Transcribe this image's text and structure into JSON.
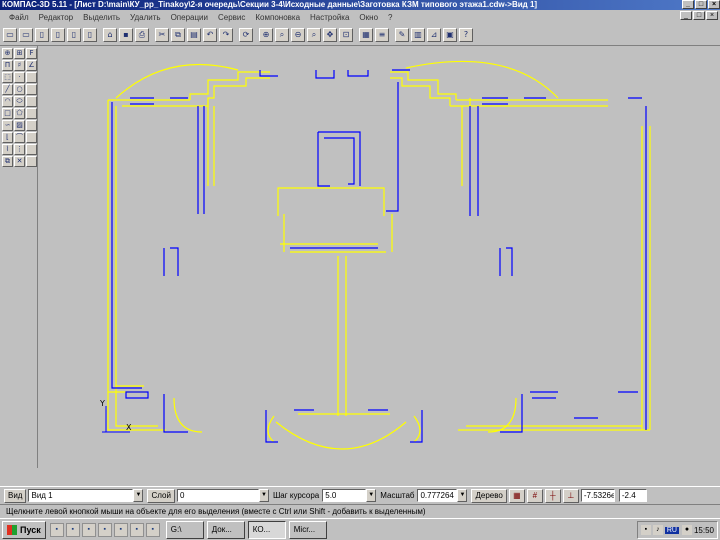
{
  "window": {
    "title": "КОМПАС-3D 5.11 - [Лист D:\\main\\КУ_pp_Tinakoy\\2-я очередь\\Секции 3-4\\Исходные данные\\Заготовка КЗМ типового этажа1.cdw->Вид 1]",
    "min_label": "_",
    "max_label": "□",
    "close_label": "×"
  },
  "menu": {
    "items": [
      "Файл",
      "Редактор",
      "Выделить",
      "Удалить",
      "Операции",
      "Сервис",
      "Компоновка",
      "Настройка",
      "Окно",
      "?"
    ]
  },
  "toolbar": {
    "buttons": [
      {
        "name": "new-document-icon",
        "glyph": "▭"
      },
      {
        "name": "new-fragment-icon",
        "glyph": "▭"
      },
      {
        "name": "new-sheet-icon",
        "glyph": "▯"
      },
      {
        "name": "new-text-icon",
        "glyph": "▯"
      },
      {
        "name": "new-part-icon",
        "glyph": "▯"
      },
      {
        "name": "new-assembly-icon",
        "glyph": "▯"
      },
      {
        "name": "open-icon",
        "glyph": "⌂"
      },
      {
        "name": "save-icon",
        "glyph": "▪"
      },
      {
        "name": "print-icon",
        "glyph": "⎙"
      },
      {
        "name": "cut-icon",
        "glyph": "✂"
      },
      {
        "name": "copy-icon",
        "glyph": "⧉"
      },
      {
        "name": "paste-icon",
        "glyph": "▤"
      },
      {
        "name": "undo-icon",
        "glyph": "↶"
      },
      {
        "name": "redo-icon",
        "glyph": "↷"
      },
      {
        "name": "refresh-icon",
        "glyph": "⟳"
      },
      {
        "name": "zoom-in-icon",
        "glyph": "⊕"
      },
      {
        "name": "zoom-window-icon",
        "glyph": "⌕"
      },
      {
        "name": "zoom-out-icon",
        "glyph": "⊖"
      },
      {
        "name": "zoom-previous-icon",
        "glyph": "⌕"
      },
      {
        "name": "pan-icon",
        "glyph": "✥"
      },
      {
        "name": "zoom-all-icon",
        "glyph": "⊡"
      },
      {
        "name": "regenerate-icon",
        "glyph": "▦"
      },
      {
        "name": "layers-icon",
        "glyph": "≡"
      },
      {
        "name": "properties-icon",
        "glyph": "✎"
      },
      {
        "name": "library-icon",
        "glyph": "▥"
      },
      {
        "name": "measure-icon",
        "glyph": "⊿"
      },
      {
        "name": "manager-icon",
        "glyph": "▣"
      },
      {
        "name": "help-icon",
        "glyph": "?"
      }
    ]
  },
  "left_tools": {
    "buttons": [
      {
        "name": "geometry-icon",
        "glyph": "⊕"
      },
      {
        "name": "dimensions-icon",
        "glyph": "⊞"
      },
      {
        "name": "text-icon",
        "glyph": "F"
      },
      {
        "name": "edit-icon",
        "glyph": "П"
      },
      {
        "name": "param-icon",
        "glyph": "♯"
      },
      {
        "name": "measure-tool-icon",
        "glyph": "∠"
      },
      {
        "name": "select-icon",
        "glyph": "⬚"
      },
      {
        "name": "point-icon",
        "glyph": "·"
      },
      {
        "name": "blank-icon",
        "glyph": ""
      },
      {
        "name": "line-icon",
        "glyph": "╱"
      },
      {
        "name": "circle-icon",
        "glyph": "○"
      },
      {
        "name": "blank2-icon",
        "glyph": ""
      },
      {
        "name": "arc-icon",
        "glyph": "◠"
      },
      {
        "name": "ellipse-icon",
        "glyph": "⬭"
      },
      {
        "name": "blank3-icon",
        "glyph": ""
      },
      {
        "name": "rect-icon",
        "glyph": "□"
      },
      {
        "name": "polygon-icon",
        "glyph": "⬠"
      },
      {
        "name": "blank4-icon",
        "glyph": ""
      },
      {
        "name": "spline-icon",
        "glyph": "∽"
      },
      {
        "name": "hatch-icon",
        "glyph": "▨"
      },
      {
        "name": "blank5-icon",
        "glyph": ""
      },
      {
        "name": "chamfer-icon",
        "glyph": "⌊"
      },
      {
        "name": "fillet-icon",
        "glyph": "⌒"
      },
      {
        "name": "blank6-icon",
        "glyph": ""
      },
      {
        "name": "contour-icon",
        "glyph": "⌇"
      },
      {
        "name": "equidistant-icon",
        "glyph": "⋮"
      },
      {
        "name": "blank7-icon",
        "glyph": ""
      },
      {
        "name": "macro-icon",
        "glyph": "⧉"
      },
      {
        "name": "break-icon",
        "glyph": "✕"
      },
      {
        "name": "blank8-icon",
        "glyph": ""
      }
    ]
  },
  "canvas": {
    "axis_x": "X",
    "axis_y": "Y",
    "colors": {
      "yellow": "#ffff00",
      "blue": "#0000ff",
      "background": "#c0c0c0"
    }
  },
  "properties": {
    "view_button": "Вид",
    "view_value": "Вид 1",
    "layer_button": "Слой",
    "layer_value": "0",
    "step_label": "Шаг курсора",
    "step_value": "5.0",
    "scale_label": "Масштаб",
    "scale_value": "0.777264",
    "tree_button": "Дерево",
    "coord_x": "-7.5326e",
    "coord_y": "-2.4"
  },
  "status": {
    "hint": "Щелкните левой кнопкой мыши на объекте для его выделения (вместе с Ctrl или Shift - добавить к выделенным)"
  },
  "taskbar": {
    "start_label": "Пуск",
    "quick_launch": [
      "ie-icon",
      "outlook-icon",
      "word-icon",
      "excel-icon",
      "explorer-icon",
      "desktop-icon",
      "media-icon"
    ],
    "tasks": [
      {
        "label": "G:\\",
        "active": false
      },
      {
        "label": "Док...",
        "active": false
      },
      {
        "label": "КО...",
        "active": true
      },
      {
        "label": "Micr...",
        "active": false
      }
    ],
    "lang": "RU",
    "clock": "15:50"
  }
}
